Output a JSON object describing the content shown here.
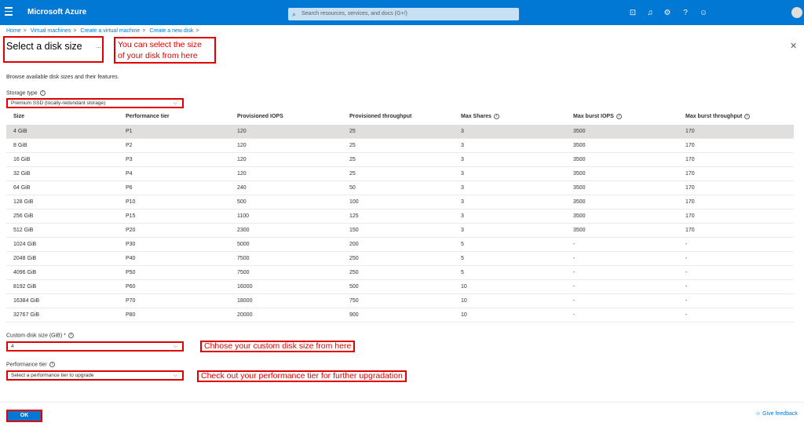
{
  "topbar": {
    "brand": "Microsoft Azure",
    "search_placeholder": "Search resources, services, and docs (G+/)"
  },
  "breadcrumb": [
    "Home",
    "Virtual machines",
    "Create a virtual machine",
    "Create a new disk",
    ""
  ],
  "title": "Select a disk size",
  "title_more": "...",
  "annotations": {
    "size_hint_line1": "You can select the size",
    "size_hint_line2": "of your disk from here",
    "custom_hint": "Chhose your custom disk size from here",
    "tier_hint": "Check out your performance tier for further upgradation"
  },
  "description": "Browse available disk sizes and their features.",
  "storage_type": {
    "label": "Storage type",
    "value": "Premium SSD (locally-redundant storage)"
  },
  "table": {
    "headers": [
      "Size",
      "Performance tier",
      "Provisioned IOPS",
      "Provisioned throughput",
      "Max Shares",
      "Max burst IOPS",
      "Max burst throughput"
    ],
    "rows": [
      [
        "4 GiB",
        "P1",
        "120",
        "25",
        "3",
        "3500",
        "170"
      ],
      [
        "8 GiB",
        "P2",
        "120",
        "25",
        "3",
        "3500",
        "170"
      ],
      [
        "16 GiB",
        "P3",
        "120",
        "25",
        "3",
        "3500",
        "170"
      ],
      [
        "32 GiB",
        "P4",
        "120",
        "25",
        "3",
        "3500",
        "170"
      ],
      [
        "64 GiB",
        "P6",
        "240",
        "50",
        "3",
        "3500",
        "170"
      ],
      [
        "128 GiB",
        "P10",
        "500",
        "100",
        "3",
        "3500",
        "170"
      ],
      [
        "256 GiB",
        "P15",
        "1100",
        "125",
        "3",
        "3500",
        "170"
      ],
      [
        "512 GiB",
        "P20",
        "2300",
        "150",
        "3",
        "3500",
        "170"
      ],
      [
        "1024 GiB",
        "P30",
        "5000",
        "200",
        "5",
        "-",
        "-"
      ],
      [
        "2048 GiB",
        "P40",
        "7500",
        "250",
        "5",
        "-",
        "-"
      ],
      [
        "4096 GiB",
        "P50",
        "7500",
        "250",
        "5",
        "-",
        "-"
      ],
      [
        "8192 GiB",
        "P60",
        "16000",
        "500",
        "10",
        "-",
        "-"
      ],
      [
        "16384 GiB",
        "P70",
        "18000",
        "750",
        "10",
        "-",
        "-"
      ],
      [
        "32767 GiB",
        "P80",
        "20000",
        "900",
        "10",
        "-",
        "-"
      ]
    ],
    "selected_row": 0
  },
  "custom_size": {
    "label": "Custom disk size (GiB) *",
    "value": "4"
  },
  "performance_tier": {
    "label": "Performance tier",
    "placeholder": "Select a performance tier to upgrade"
  },
  "ok_label": "OK",
  "feedback_label": "Give feedback",
  "colors": {
    "azure_blue": "#0078d4",
    "annotation_red": "#e00000",
    "selected_row": "#e1dfdd"
  }
}
